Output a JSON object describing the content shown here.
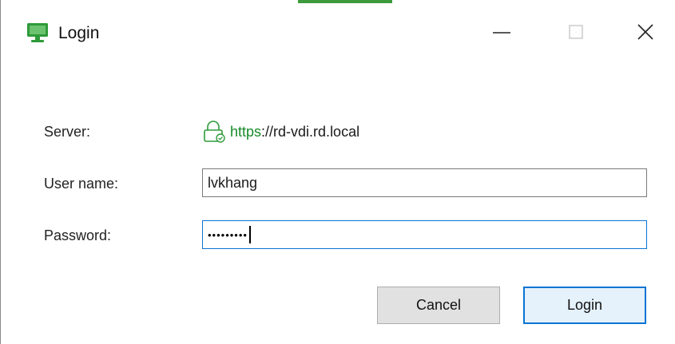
{
  "window": {
    "title": "Login",
    "accent_color": "#3c9a3c"
  },
  "titlebar_buttons": {
    "minimize_icon": "minimize-icon",
    "maximize_icon": "maximize-icon",
    "close_icon": "close-icon"
  },
  "form": {
    "server_label": "Server:",
    "server_scheme": "https",
    "server_separator": "://",
    "server_host": "rd-vdi.rd.local",
    "server_icon": "lock-icon",
    "server_scheme_color": "#178a28",
    "username_label": "User name:",
    "username_value": "lvkhang",
    "password_label": "Password:",
    "password_value": "•••••••••"
  },
  "buttons": {
    "cancel_label": "Cancel",
    "login_label": "Login",
    "focus_color": "#0a74d4"
  }
}
